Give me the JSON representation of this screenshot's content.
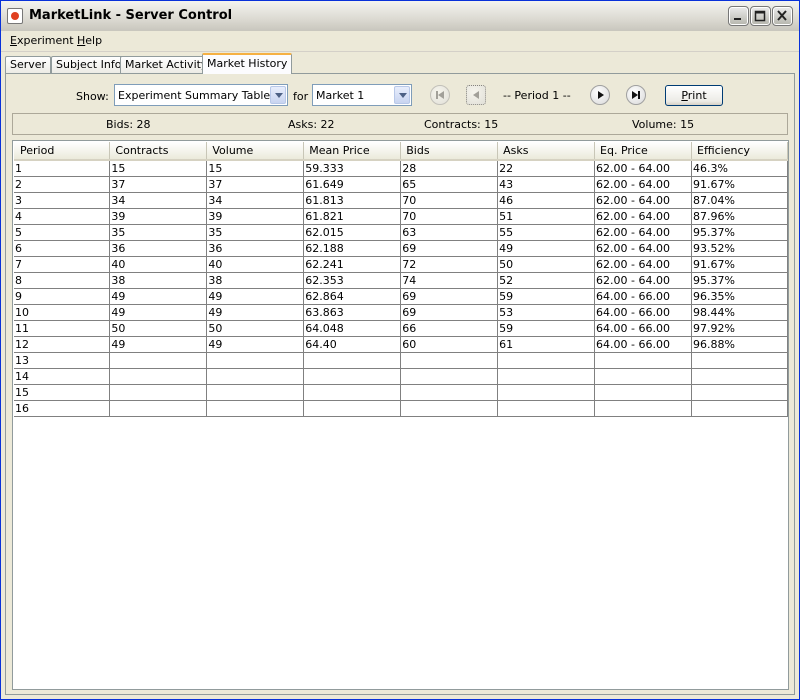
{
  "window": {
    "title": "MarketLink - Server Control"
  },
  "menu": [
    {
      "label": "Experiment",
      "mnemonic": "E",
      "rest": "xperiment"
    },
    {
      "label": "Help",
      "mnemonic": "H",
      "rest": "elp"
    }
  ],
  "tabs": [
    "Server",
    "Subject Info",
    "Market Activity",
    "Market History"
  ],
  "active_tab": "Market History",
  "controls": {
    "show_label": "Show:",
    "show_value": "Experiment Summary Table",
    "for_label": "for",
    "market_value": "Market 1",
    "period_label": "-- Period 1 --",
    "print_label": "Print",
    "print_mnemonic": "P",
    "print_rest": "rint"
  },
  "summary": {
    "bids": "Bids: 28",
    "asks": "Asks: 22",
    "contracts": "Contracts: 15",
    "volume": "Volume: 15"
  },
  "table": {
    "columns": [
      "Period",
      "Contracts",
      "Volume",
      "Mean Price",
      "Bids",
      "Asks",
      "Eq. Price",
      "Efficiency"
    ],
    "rows": [
      [
        "1",
        "15",
        "15",
        "59.333",
        "28",
        "22",
        "62.00 - 64.00",
        "46.3%"
      ],
      [
        "2",
        "37",
        "37",
        "61.649",
        "65",
        "43",
        "62.00 - 64.00",
        "91.67%"
      ],
      [
        "3",
        "34",
        "34",
        "61.813",
        "70",
        "46",
        "62.00 - 64.00",
        "87.04%"
      ],
      [
        "4",
        "39",
        "39",
        "61.821",
        "70",
        "51",
        "62.00 - 64.00",
        "87.96%"
      ],
      [
        "5",
        "35",
        "35",
        "62.015",
        "63",
        "55",
        "62.00 - 64.00",
        "95.37%"
      ],
      [
        "6",
        "36",
        "36",
        "62.188",
        "69",
        "49",
        "62.00 - 64.00",
        "93.52%"
      ],
      [
        "7",
        "40",
        "40",
        "62.241",
        "72",
        "50",
        "62.00 - 64.00",
        "91.67%"
      ],
      [
        "8",
        "38",
        "38",
        "62.353",
        "74",
        "52",
        "62.00 - 64.00",
        "95.37%"
      ],
      [
        "9",
        "49",
        "49",
        "62.864",
        "69",
        "59",
        "64.00 - 66.00",
        "96.35%"
      ],
      [
        "10",
        "49",
        "49",
        "63.863",
        "69",
        "53",
        "64.00 - 66.00",
        "98.44%"
      ],
      [
        "11",
        "50",
        "50",
        "64.048",
        "66",
        "59",
        "64.00 - 66.00",
        "97.92%"
      ],
      [
        "12",
        "49",
        "49",
        "64.40",
        "60",
        "61",
        "64.00 - 66.00",
        "96.88%"
      ],
      [
        "13",
        "",
        "",
        "",
        "",
        "",
        "",
        ""
      ],
      [
        "14",
        "",
        "",
        "",
        "",
        "",
        "",
        ""
      ],
      [
        "15",
        "",
        "",
        "",
        "",
        "",
        "",
        ""
      ],
      [
        "16",
        "",
        "",
        "",
        "",
        "",
        "",
        ""
      ]
    ]
  }
}
